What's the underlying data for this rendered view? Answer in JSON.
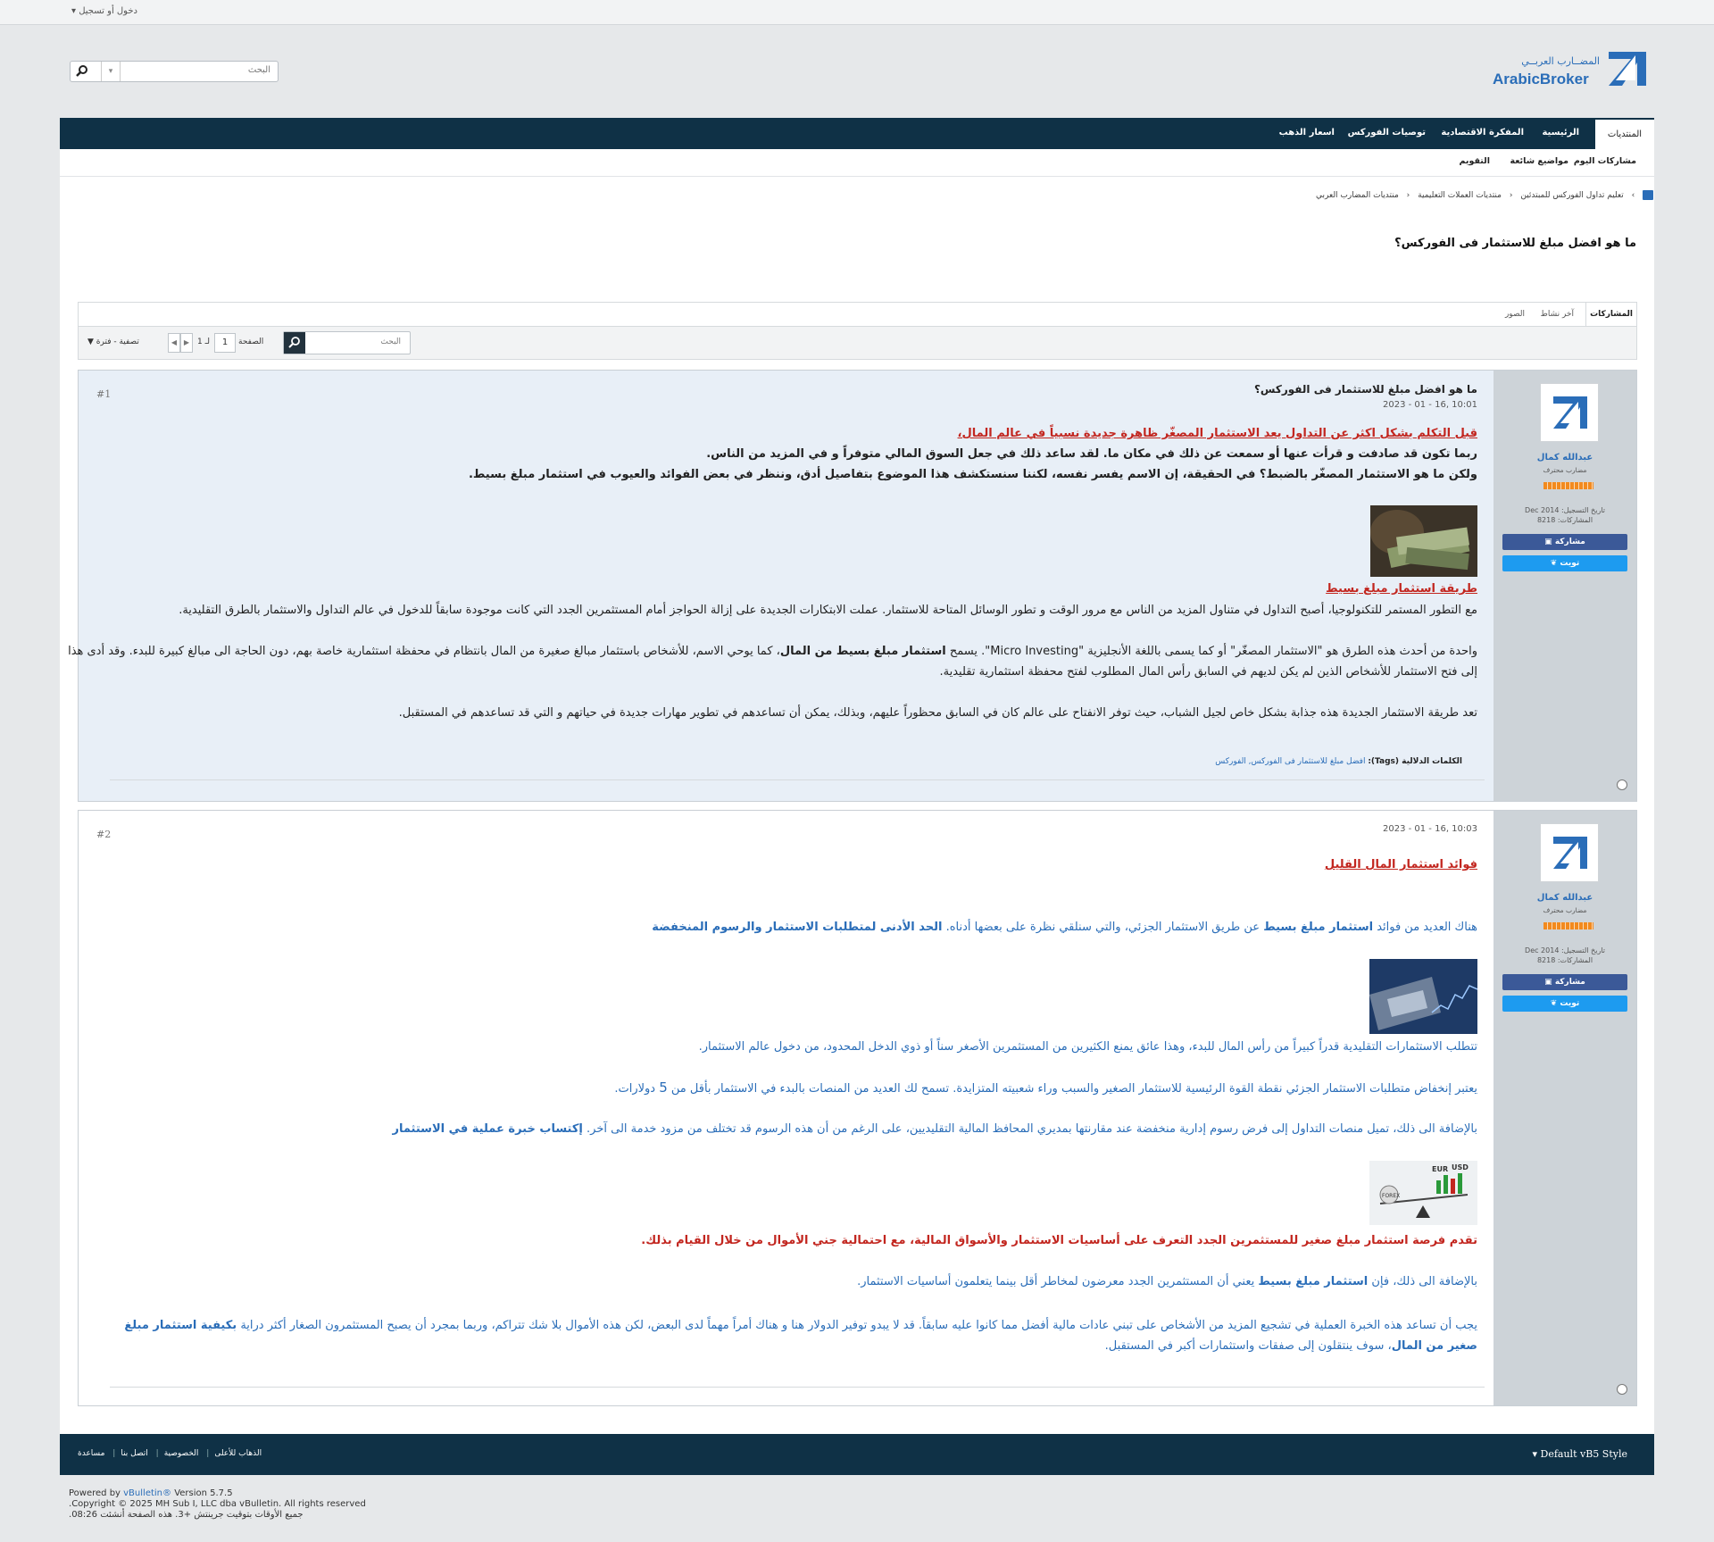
{
  "topbar": {
    "login": "دخول أو تسجيل"
  },
  "logo": {
    "arabic": "المضــارب العربــي",
    "latin": "ArabicBroker"
  },
  "search": {
    "placeholder": "البحث"
  },
  "nav": {
    "items": [
      "المنتديات",
      "الرئيسية",
      "المفكرة الاقتصادية",
      "توصيات الفوركس",
      "اسعار الذهب"
    ],
    "sub": [
      "مشاركات اليوم",
      "مواضيع شائعة",
      "التقويم"
    ]
  },
  "breadcrumb": [
    "منتديات المضارب العربي",
    "منتديات العملات التعليمية",
    "تعليم تداول الفوركس للمبتدئين"
  ],
  "thread_title": "ما هو افضل مبلغ للاستثمار فى الفوركس؟",
  "tabs": [
    "المشاركات",
    "آخر نشاط",
    "الصور"
  ],
  "toolbar": {
    "search_placeholder": "البحث",
    "page_label": "الصفحة",
    "page": "1",
    "of": "لـ 1",
    "filter": "تصفية - فترة"
  },
  "posts": [
    {
      "number": "#1",
      "date": "2023 - 01 - 16, 10:01",
      "title": "ما هو افضل مبلغ للاستثمار فى الفوركس؟",
      "author": {
        "name": "عبدالله كمال",
        "title": "مضارب محترف",
        "reg": "تاريخ التسجيل: Dec 2014",
        "posts": "المشاركات: 8218",
        "share": "مشاركة",
        "tweet": "تويت"
      },
      "intro_red": "قبل التكلم بشكل اكثر عن التداول يعد الاستثمار المصغّر ظاهرة جديدة نسبياً في عالم المال،",
      "line2": "ربما تكون قد صادفت و قرأت عنها أو سمعت عن ذلك في مكان ما. لقد ساعد ذلك في جعل السوق المالي متوفراً و في المزيد من الناس.",
      "line3": "ولكن ما هو الاستثمار المصغّر بالضبط؟ في الحقيقة، إن الاسم يفسر نفسه، لكننا سنستكشف هذا الموضوع بتفاصيل أدق، وننظر في بعض الفوائد والعيوب في استثمار مبلغ بسيط.",
      "subheading": "طريقة استثمار مبلغ بسيط",
      "para1": "مع التطور المستمر للتكنولوجيا، أصبح التداول في متناول المزيد من الناس مع مرور الوقت و تطور الوسائل المتاحة للاستثمار. عملت الابتكارات الجديدة على إزالة الحواجز أمام المستثمرين الجدد التي كانت موجودة سابقاً للدخول في عالم التداول والاستثمار بالطرق التقليدية.",
      "para2_a": "واحدة من أحدث هذه الطرق هو \"الاستثمار المصغّر\" أو كما يسمى باللغة الأنجليزية \"Micro Investing\". يسمح ",
      "para2_b": "استثمار مبلغ بسيط من المال",
      "para2_c": "، كما يوحي الاسم، للأشخاص باستثمار مبالغ صغيرة من المال بانتظام في محفظة استثمارية خاصة بهم، دون الحاجة الى مبالغ كبيرة للبدء. وقد أدى هذا",
      "para2_d": "إلى فتح الاستثمار للأشخاص الذين لم يكن لديهم في السابق رأس المال المطلوب لفتح محفظة استثمارية تقليدية.",
      "para3": "تعد طريقة الاستثمار الجديدة هذه جذابة بشكل خاص لجيل الشباب، حيث توفر الانفتاح على عالم كان في السابق محظوراً عليهم، وبذلك، يمكن أن تساعدهم في تطوير مهارات جديدة في حياتهم و التي قد تساعدهم في المستقبل.",
      "tags_label": "الكلمات الدلالية (Tags):",
      "tags": "افضل مبلغ للاستثمار فى الفوركس, الفوركس"
    },
    {
      "number": "#2",
      "date": "2023 - 01 - 16, 10:03",
      "author": {
        "name": "عبدالله كمال",
        "title": "مضارب محترف",
        "reg": "تاريخ التسجيل: Dec 2014",
        "posts": "المشاركات: 8218",
        "share": "مشاركة",
        "tweet": "تويت"
      },
      "heading": "فوائد استثمار المال القليل",
      "p1_a": "هناك العديد من فوائد ",
      "p1_b": "استثمار مبلغ بسيط",
      "p1_c": " عن طريق الاستثمار الجزئي، والتي سنلقي نظرة على بعضها أدناه. ",
      "p1_d": "الحد الأدنى لمتطلبات الاستثمار والرسوم المنخفضة",
      "p2": "تتطلب الاستثمارات التقليدية قدراً كبيراً من رأس المال للبدء، وهذا عائق يمنع الكثيرين من المستثمرين الأصغر سناً أو ذوي الدخل المحدود، من دخول عالم الاستثمار.",
      "p3_a": "يعتبر إنخفاض متطلبات الاستثمار الجزئي نقطة القوة الرئيسية للاستثمار الصغير والسبب وراء شعبيته المتزايدة. تسمح لك العديد من المنصات بالبدء في الاستثمار بأقل من ",
      "p3_b": "5",
      "p3_c": " دولارات.",
      "p4_a": "بالإضافة الى ذلك، تميل منصات التداول إلى فرض رسوم إدارية منخفضة عند مقارنتها بمديري المحافظ المالية التقليديين، على الرغم من أن هذه الرسوم قد تختلف من مزود خدمة الى آخر. ",
      "p4_b": "إكتساب خبرة عملية في الاستثمار",
      "p5": "تقدم فرصة استثمار مبلغ صغير للمستثمرين الجدد التعرف على أساسيات الاستثمار والأسواق المالية، مع احتمالية جني الأموال من خلال القيام بذلك.",
      "p6_a": "بالإضافة الى ذلك، فإن ",
      "p6_b": "استثمار مبلغ بسيط",
      "p6_c": " يعني أن المستثمرين الجدد معرضون لمخاطر أقل بينما يتعلمون أساسيات الاستثمار.",
      "p7_a": "يجب أن تساعد هذه الخبرة العملية في تشجيع المزيد من الأشخاص على تبني عادات مالية أفضل مما كانوا عليه سابقاً. قد لا يبدو توفير الدولار هنا و هناك أمراً مهماً لدى البعض، لكن هذه الأموال بلا شك تتراكم، وربما بمجرد أن يصبح المستثمرون الصغار أكثر دراية ",
      "p7_b": "بكيفية استثمار مبلغ صغير من المال",
      "p7_c": "، سوف ينتقلون إلى صفقات واستثمارات أكبر في المستقبل.",
      "image_text": {
        "forex": "FOREX",
        "eur": "EUR",
        "usd": "USD"
      }
    }
  ],
  "footer": {
    "links": [
      "مساعدة",
      "اتصل بنا",
      "الخصوصية",
      "الذهاب للأعلى"
    ],
    "style": "Default vB5 Style",
    "powered_a": "Powered by ",
    "powered_b": "vBulletin®",
    "powered_c": " Version 5.7.5",
    "copyright": "Copyright © 2025 MH Sub I, LLC dba vBulletin. All rights reserved.",
    "time": "جميع الأوقات بتوقيت جرينتش +3. هذه الصفحة أنشئت 08:26."
  },
  "colors": {
    "nav": "#0f3146",
    "accent_blue": "#2a6db8",
    "accent_red": "#c2261f",
    "post_bg": "#e8eff7"
  }
}
